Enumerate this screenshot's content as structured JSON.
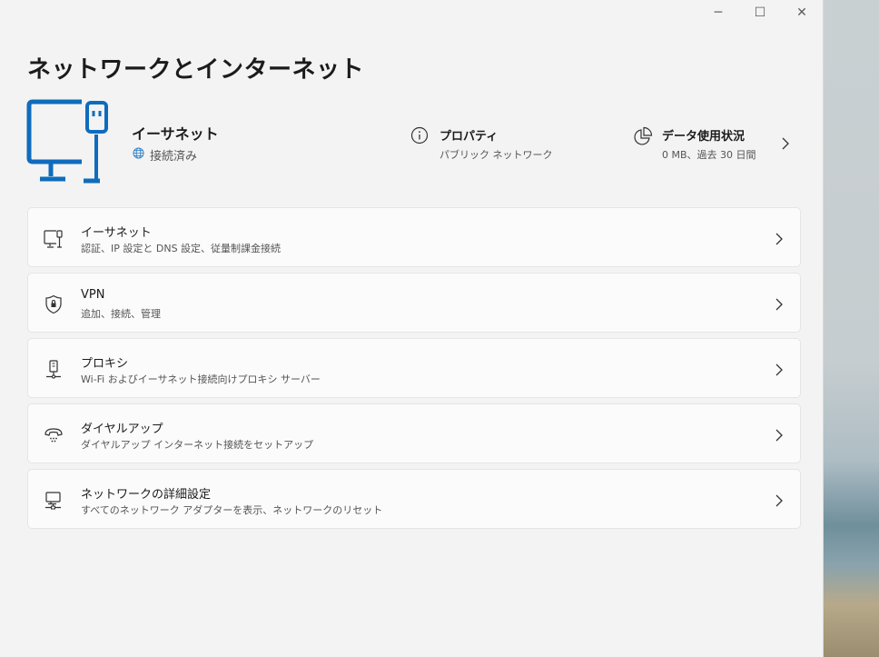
{
  "window": {
    "minimize_glyph": "─",
    "maximize_glyph": "☐",
    "close_glyph": "✕"
  },
  "page_title": "ネットワークとインターネット",
  "hero": {
    "name": "イーサネット",
    "status": "接続済み",
    "icon": "ethernet-monitor-icon",
    "accent": "#0f6cbd"
  },
  "properties": {
    "title": "プロパティ",
    "subtitle": "パブリック ネットワーク",
    "icon": "info-icon"
  },
  "data_usage": {
    "title": "データ使用状況",
    "subtitle": "0 MB、過去 30 日間",
    "icon": "pie-chart-icon"
  },
  "settings": [
    {
      "title": "イーサネット",
      "subtitle": "認証、IP 設定と DNS 設定、従量制課金接続",
      "icon": "ethernet-icon"
    },
    {
      "title": "VPN",
      "subtitle": "追加、接続、管理",
      "icon": "vpn-shield-icon"
    },
    {
      "title": "プロキシ",
      "subtitle": "Wi-Fi およびイーサネット接続向けプロキシ サーバー",
      "icon": "proxy-icon"
    },
    {
      "title": "ダイヤルアップ",
      "subtitle": "ダイヤルアップ インターネット接続をセットアップ",
      "icon": "dialup-phone-icon"
    },
    {
      "title": "ネットワークの詳細設定",
      "subtitle": "すべてのネットワーク アダプターを表示、ネットワークのリセット",
      "icon": "network-adapter-icon"
    }
  ]
}
